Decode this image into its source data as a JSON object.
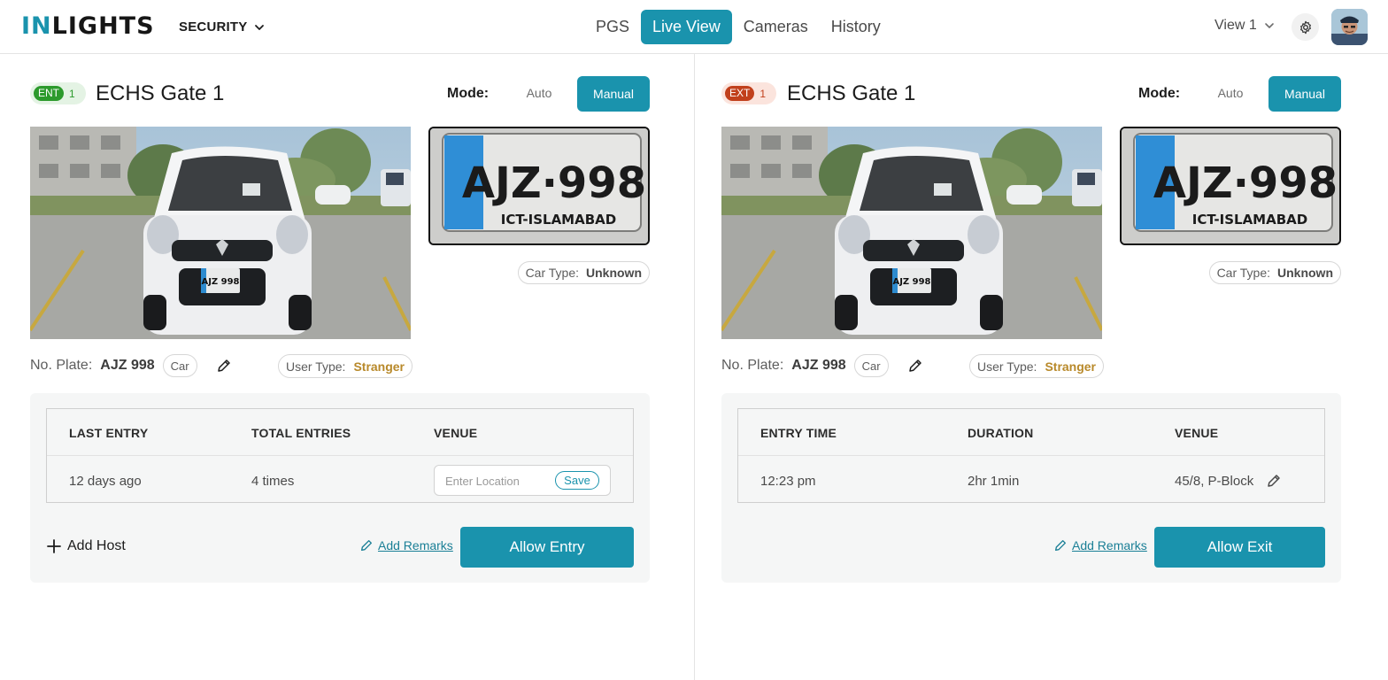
{
  "header": {
    "logo_prefix": "IN",
    "logo_rest": "LIGHTS",
    "org_label": "SECURITY",
    "nav": [
      "PGS",
      "Live View",
      "Cameras",
      "History"
    ],
    "active_nav": "Live View",
    "view_label": "View 1",
    "icons": {
      "org_dropdown": "chevron-down-icon",
      "view_dropdown": "chevron-down-icon",
      "settings": "gear-icon",
      "user": "avatar"
    }
  },
  "colors": {
    "accent": "#1a93ad",
    "entry_badge": "#2c9a2c",
    "exit_badge": "#c1401c",
    "user_type_value": "#b8892a"
  },
  "entry_panel": {
    "badge_tag": "ENT",
    "badge_num": "1",
    "gate_name": "ECHS Gate 1",
    "mode_label": "Mode:",
    "mode_auto": "Auto",
    "mode_manual": "Manual",
    "mode_selected": "Manual",
    "plate_image_text": "AJZ·998",
    "plate_image_subtext": "ICT-ISLAMABAD",
    "car_type_label": "Car Type:",
    "car_type_value": "Unknown",
    "plate_label": "No. Plate:",
    "plate_value": "AJZ 998",
    "vehicle_pill": "Car",
    "user_type_label": "User Type:",
    "user_type_value": "Stranger",
    "table_headers": [
      "LAST ENTRY",
      "TOTAL ENTRIES",
      "VENUE"
    ],
    "table_values": [
      "12 days ago",
      "4 times"
    ],
    "location_placeholder": "Enter Location",
    "save_label": "Save",
    "add_host_label": "Add Host",
    "add_remarks_label": "Add Remarks",
    "primary_label": "Allow Entry"
  },
  "exit_panel": {
    "badge_tag": "EXT",
    "badge_num": "1",
    "gate_name": "ECHS Gate 1",
    "mode_label": "Mode:",
    "mode_auto": "Auto",
    "mode_manual": "Manual",
    "mode_selected": "Manual",
    "plate_image_text": "AJZ·998",
    "plate_image_subtext": "ICT-ISLAMABAD",
    "car_type_label": "Car Type:",
    "car_type_value": "Unknown",
    "plate_label": "No. Plate:",
    "plate_value": "AJZ 998",
    "vehicle_pill": "Car",
    "user_type_label": "User Type:",
    "user_type_value": "Stranger",
    "table_headers": [
      "ENTRY TIME",
      "DURATION",
      "VENUE"
    ],
    "table_values": [
      "12:23 pm",
      "2hr 1min",
      "45/8, P-Block"
    ],
    "add_remarks_label": "Add Remarks",
    "primary_label": "Allow Exit"
  }
}
